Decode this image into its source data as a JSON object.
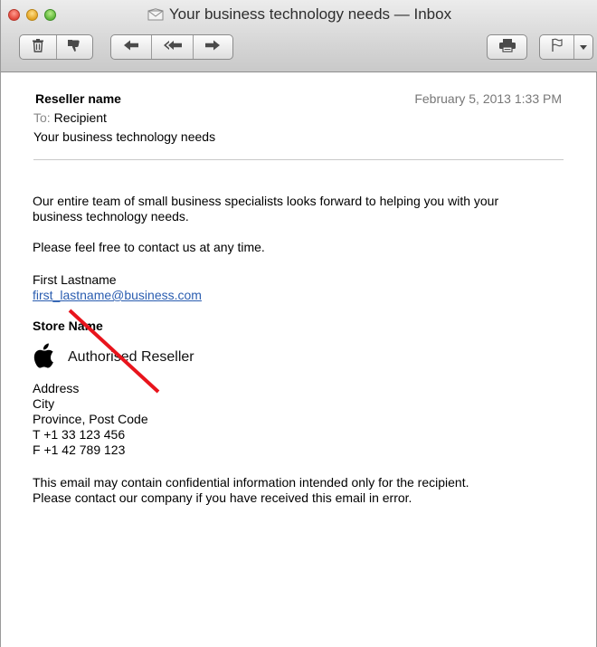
{
  "window": {
    "title": "Your business technology needs — Inbox"
  },
  "toolbar": {
    "delete_icon": "trash-icon",
    "junk_icon": "thumbs-down-icon",
    "reply_icon": "reply-arrow-icon",
    "reply_all_icon": "reply-all-arrow-icon",
    "forward_icon": "forward-arrow-icon",
    "print_icon": "printer-icon",
    "flag_icon": "flag-icon",
    "flag_menu_icon": "chevron-down-icon"
  },
  "header": {
    "from": "Reseller name",
    "date": "February 5, 2013  1:33 PM",
    "to_label": "To:",
    "to_value": "Recipient",
    "subject": "Your business technology needs"
  },
  "body": {
    "intro_line1": "Our entire team of small business specialists looks forward to helping you with your",
    "intro_line2": "business technology needs.",
    "contact_line": "Please feel free to contact us at any time.",
    "signature_name": "First Lastname",
    "signature_email": "first_lastname@business.com",
    "store_name": "Store Name",
    "authorised_reseller": "Authorised Reseller",
    "address_line": "Address",
    "city_line": "City",
    "province_line": "Province, Post Code",
    "phone_line": "T +1 33 123 456",
    "fax_line": "F +1 42 789 123",
    "disclaimer_line1": "This email may contain confidential information intended only for the recipient.",
    "disclaimer_line2": "Please contact our company if you have received this email in error."
  },
  "colors": {
    "link": "#2a5db0",
    "annotation_line": "#e8141c",
    "date_text": "#777777"
  }
}
